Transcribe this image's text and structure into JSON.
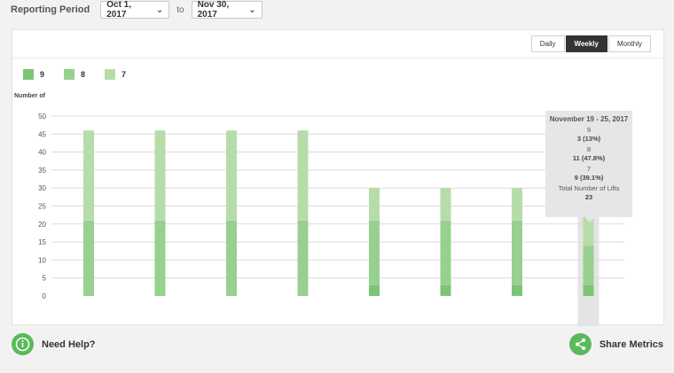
{
  "header": {
    "reporting_label": "Reporting Period",
    "start_date": "Oct 1, 2017",
    "to_label": "to",
    "end_date": "Nov 30, 2017"
  },
  "view_toggle": {
    "daily": "Daily",
    "weekly": "Weekly",
    "monthly": "Monthly",
    "active": "weekly"
  },
  "legend": [
    {
      "label": "9",
      "color": "#7cc576"
    },
    {
      "label": "8",
      "color": "#98d08f"
    },
    {
      "label": "7",
      "color": "#b6dda9"
    }
  ],
  "chart_data": {
    "type": "bar",
    "stacked": true,
    "ylabel": "Number of",
    "ylim": [
      0,
      50
    ],
    "yticks": [
      0,
      5,
      10,
      15,
      20,
      25,
      30,
      35,
      40,
      45,
      50
    ],
    "categories": [
      "",
      "",
      "",
      "",
      "",
      "",
      "",
      ""
    ],
    "series": [
      {
        "name": "9",
        "color": "#7cc576",
        "values": [
          0,
          0,
          0,
          0,
          3,
          3,
          3,
          3
        ]
      },
      {
        "name": "8",
        "color": "#98d08f",
        "values": [
          21,
          21,
          21,
          21,
          18,
          18,
          18,
          11
        ]
      },
      {
        "name": "7",
        "color": "#b6dda9",
        "values": [
          25,
          25,
          25,
          25,
          9,
          9,
          9,
          9
        ]
      }
    ],
    "highlight_index": 7
  },
  "tooltip": {
    "title": "November 19 - 25, 2017",
    "s9_label": "9",
    "s9_value": "3 (13%)",
    "s8_label": "8",
    "s8_value": "11 (47.8%)",
    "s7_label": "7",
    "s7_value": "9 (39.1%)",
    "total_label": "Total Number of Lifts",
    "total_value": "23"
  },
  "footer": {
    "help_label": "Need Help?",
    "share_label": "Share Metrics"
  }
}
